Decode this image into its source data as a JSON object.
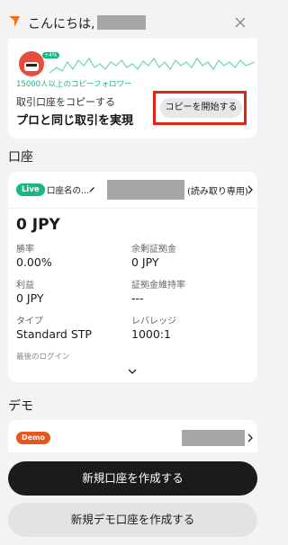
{
  "header": {
    "greeting": "こんにちは,",
    "close_icon": "close-icon",
    "logo_icon": "orange-arrow-logo-icon"
  },
  "promo": {
    "followers": "15000人以上のコピーフォロワー",
    "line1": "取引口座をコピーする",
    "line2": "プロと同じ取引を実現",
    "start_label": "コピーを開始する",
    "avatar_badge": "+4%",
    "highlight_color": "#e2231a"
  },
  "accounts": {
    "section_title": "口座",
    "live_badge": "Live",
    "account_name": "口座名の...",
    "readonly": "(読み取り専用)",
    "balance": "0 JPY",
    "fields": [
      {
        "label": "勝率",
        "value": "0.00%"
      },
      {
        "label": "余剰証拠金",
        "value": "0 JPY"
      },
      {
        "label": "利益",
        "value": "0 JPY"
      },
      {
        "label": "証拠金維持率",
        "value": "---"
      },
      {
        "label": "タイプ",
        "value": "Standard STP"
      },
      {
        "label": "レバレッジ",
        "value": "1000:1"
      }
    ],
    "last_login_label": "最後のログイン"
  },
  "demo": {
    "section_title": "デモ",
    "badge": "Demo"
  },
  "actions": {
    "create_account": "新規口座を作成する",
    "create_demo": "新規デモ口座を作成する"
  },
  "colors": {
    "accent_orange": "#ff6a1a",
    "live_green": "#18b77f",
    "demo_orange": "#e5571f",
    "chart_teal": "#6ad3c0"
  }
}
